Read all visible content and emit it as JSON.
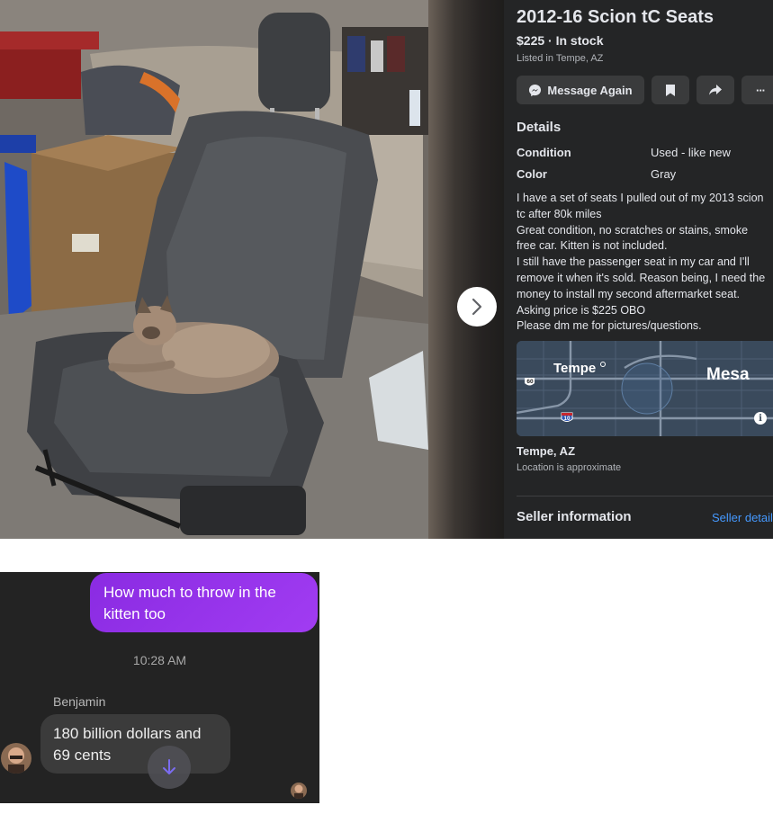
{
  "listing": {
    "title": "2012-16 Scion tC Seats",
    "price_status": "$225 · In stock",
    "listed_in": "Listed in Tempe, AZ",
    "buttons": {
      "message": "Message Again",
      "more": "···"
    },
    "details": {
      "heading": "Details",
      "condition_label": "Condition",
      "condition_value": "Used - like new",
      "color_label": "Color",
      "color_value": "Gray",
      "description": [
        "I have a set of seats I pulled out of my 2013 scion",
        "tc after 80k miles",
        "Great condition, no scratches or stains, smoke",
        "free car. Kitten is not included.",
        "I still have the passenger seat in my car and I'll",
        "remove it when it's sold. Reason being, I need the",
        "money to install my second aftermarket seat.",
        "Asking price is $225 OBO",
        "Please dm me for pictures/questions."
      ]
    },
    "map": {
      "city_a": "Tempe",
      "city_b": "Mesa",
      "route_60": "60",
      "route_10": "10"
    },
    "location": "Tempe, AZ",
    "location_note": "Location is approximate",
    "seller_heading": "Seller information",
    "seller_link": "Seller details"
  },
  "chat": {
    "outgoing": [
      "How much to throw in the",
      "kitten too"
    ],
    "timestamp": "10:28 AM",
    "sender": "Benjamin",
    "incoming": [
      "180 billion dollars and",
      "69 cents"
    ]
  },
  "colors": {
    "panel_bg": "#242526",
    "button_bg": "#3a3b3c",
    "link": "#4599ff",
    "outgoing_bubble": "#9333ea",
    "incoming_bubble": "#3b3b3b"
  }
}
